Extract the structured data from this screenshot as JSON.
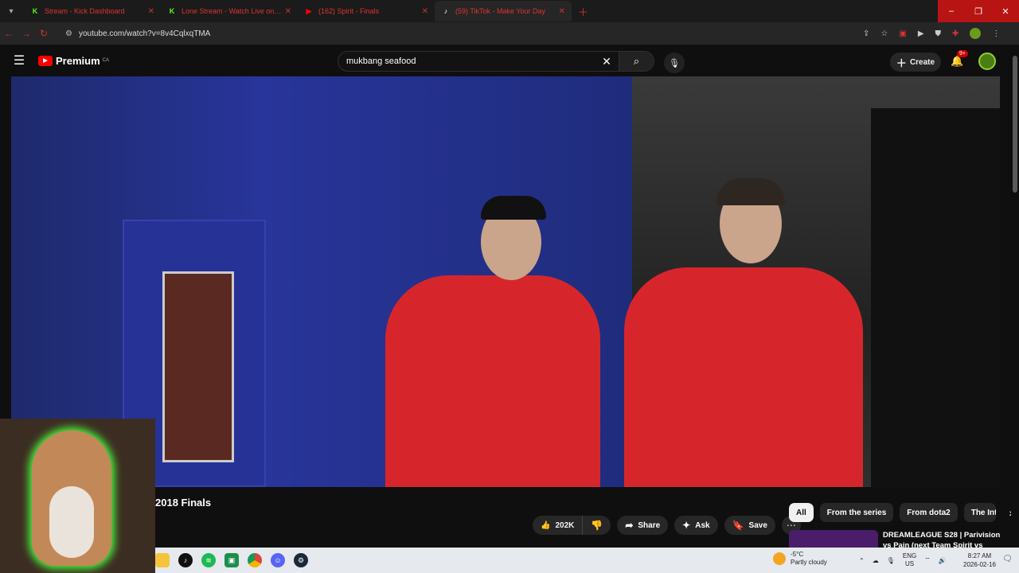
{
  "browser": {
    "tabs": [
      {
        "title": "Stream - Kick Dashboard",
        "favicon": "K",
        "favicon_color": "#53fc18"
      },
      {
        "title": "Lone Stream - Watch Live on Kick",
        "favicon": "K",
        "favicon_color": "#53fc18"
      },
      {
        "title": "(162) Spirit - Finals",
        "favicon": "▶",
        "favicon_color": "#ff0000"
      },
      {
        "title": "(59) TikTok - Make Your Day",
        "favicon": "♪",
        "favicon_color": "#ffffff"
      }
    ],
    "url": "youtube.com/watch?v=8v4CqlxqTMA",
    "window_controls": [
      "–",
      "❐",
      "✕"
    ]
  },
  "youtube": {
    "logo_text": "Premium",
    "country_code": "CA",
    "search_value": "mukbang seafood",
    "create_label": "Create",
    "notifications_badge": "9+",
    "video_title": "2018 Finals",
    "like_count": "202K",
    "share_label": "Share",
    "ask_label": "Ask",
    "save_label": "Save",
    "chips": [
      "All",
      "From the series",
      "From dota2",
      "The Inte"
    ],
    "recommended": [
      {
        "title": "DREAMLEAGUE S28 | Parivision vs Pain (next Team Spirit vs"
      }
    ]
  },
  "taskbar": {
    "weather_temp": "-5°C",
    "weather_desc": "Partly cloudy",
    "lang": "ENG",
    "region": "US",
    "time": "8:27 AM",
    "date": "2026-02-16"
  },
  "colors": {
    "accent": "#ff0000",
    "background": "#0f0f0f",
    "chip_selected": "#f1f1f1"
  }
}
